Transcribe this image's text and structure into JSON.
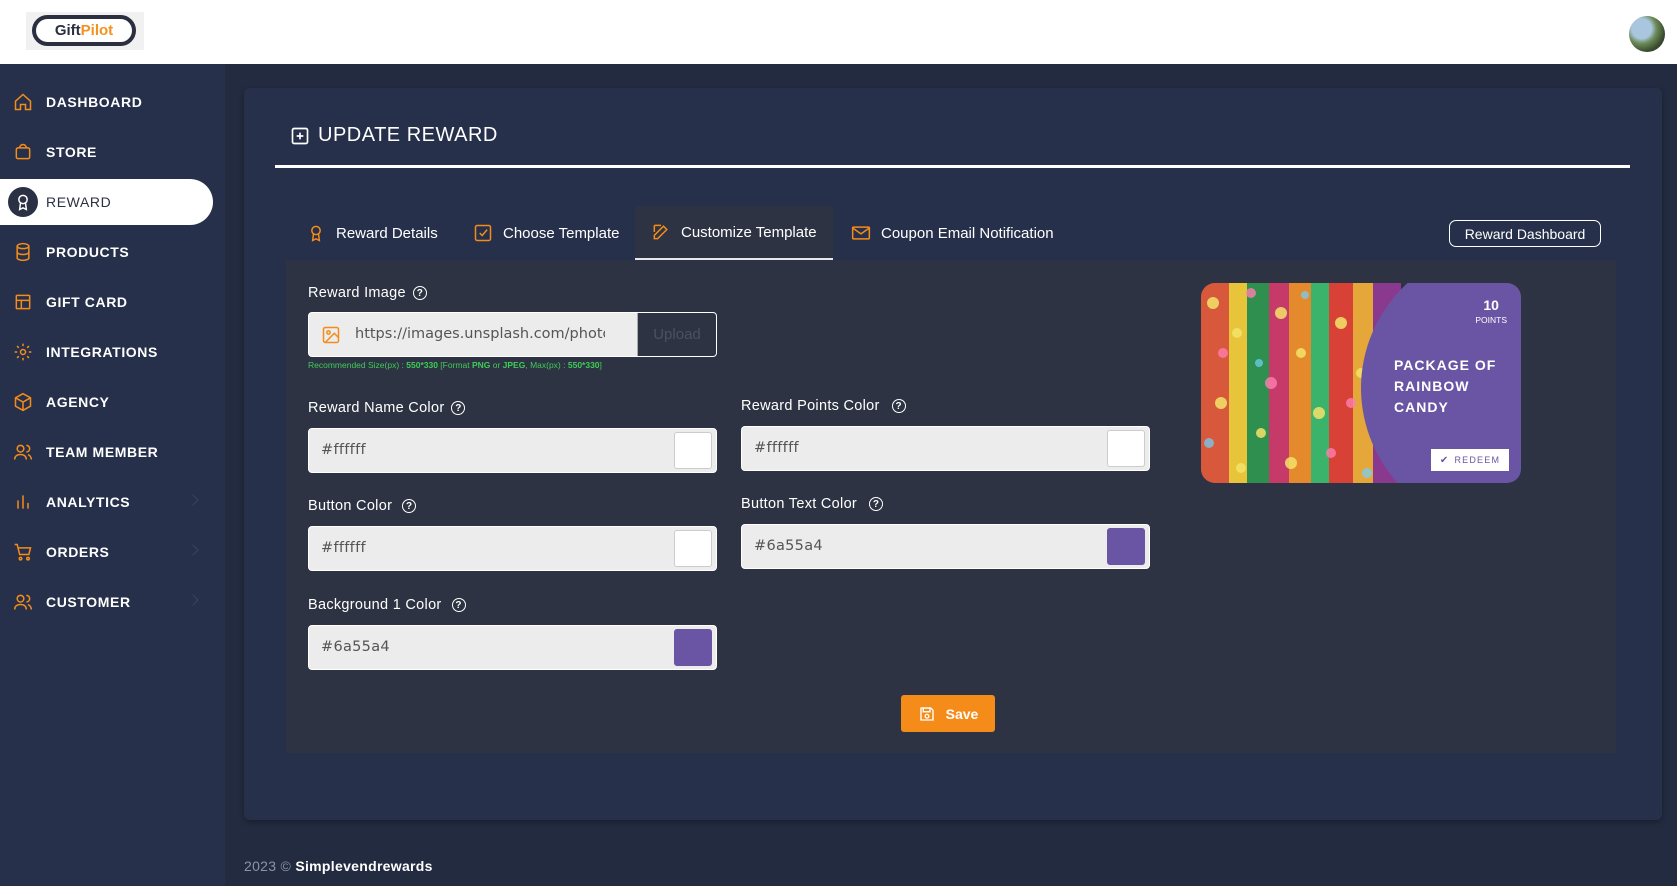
{
  "brand": {
    "logo_part1": "Gift",
    "logo_part2": "Pilot",
    "accent": "#f58c1a"
  },
  "sidebar": {
    "items": [
      {
        "label": "DASHBOARD",
        "icon": "home-icon"
      },
      {
        "label": "STORE",
        "icon": "store-icon"
      },
      {
        "label": "REWARD",
        "icon": "award-icon",
        "active": true
      },
      {
        "label": "PRODUCTS",
        "icon": "database-icon"
      },
      {
        "label": "GIFT CARD",
        "icon": "gift-card-icon"
      },
      {
        "label": "INTEGRATIONS",
        "icon": "gear-icon"
      },
      {
        "label": "AGENCY",
        "icon": "box-icon"
      },
      {
        "label": "TEAM MEMBER",
        "icon": "users-icon"
      },
      {
        "label": "ANALYTICS",
        "icon": "bar-chart-icon"
      },
      {
        "label": "ORDERS",
        "icon": "cart-icon"
      },
      {
        "label": "CUSTOMER",
        "icon": "users-icon"
      }
    ]
  },
  "page": {
    "title": "UPDATE REWARD"
  },
  "tabs": [
    {
      "label": "Reward Details",
      "icon": "award-icon"
    },
    {
      "label": "Choose Template",
      "icon": "check-square-icon"
    },
    {
      "label": "Customize Template",
      "icon": "edit-icon",
      "active": true
    },
    {
      "label": "Coupon Email Notification",
      "icon": "mail-icon"
    }
  ],
  "reward_dashboard_label": "Reward Dashboard",
  "form": {
    "reward_image": {
      "label": "Reward Image",
      "value": "https://images.unsplash.com/photo",
      "upload_label": "Upload",
      "hint_prefix": "Recommended Size(px) : ",
      "hint_size": "550*330",
      "hint_mid1": " [Format ",
      "hint_png": "PNG",
      "hint_or": " or ",
      "hint_jpeg": "JPEG",
      "hint_mid2": ", Max(px) : ",
      "hint_max": "550*330",
      "hint_end": "]"
    },
    "reward_name_color": {
      "label": "Reward Name Color",
      "value": "#ffffff"
    },
    "reward_points_color": {
      "label": "Reward Points Color",
      "value": "#ffffff"
    },
    "button_color": {
      "label": "Button Color",
      "value": "#ffffff"
    },
    "button_text_color": {
      "label": "Button Text Color",
      "value": "#6a55a4"
    },
    "background_1_color": {
      "label": "Background 1 Color",
      "value": "#6a55a4"
    },
    "save_label": "Save"
  },
  "preview": {
    "points_value": "10",
    "points_unit": "POINTS",
    "reward_name": "PACKAGE OF RAINBOW CANDY",
    "redeem_label": "REDEEM",
    "background_color": "#6a55a4"
  },
  "footer": {
    "year": "2023 ©",
    "company": "Simplevendrewards"
  }
}
